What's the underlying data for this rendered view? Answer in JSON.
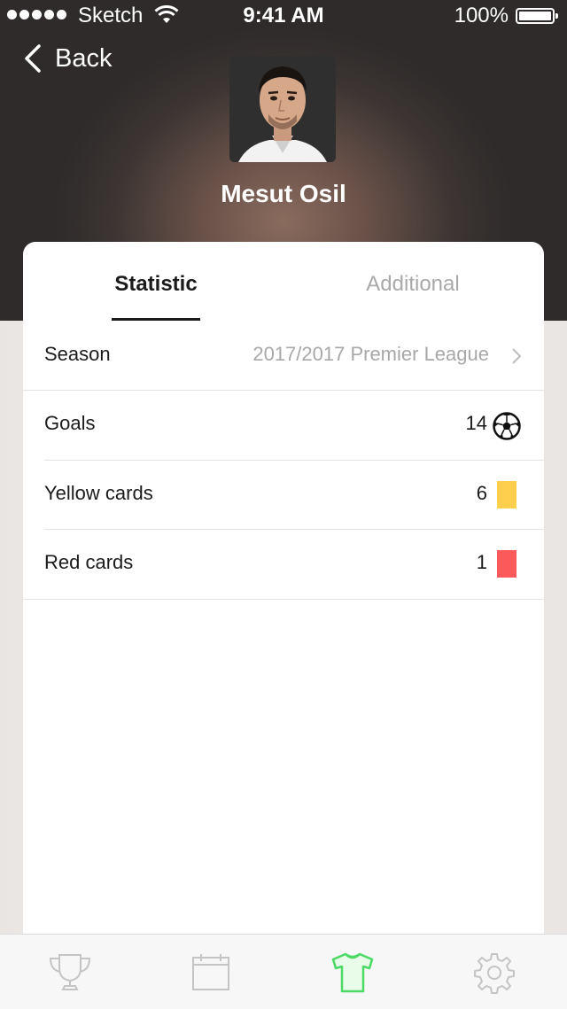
{
  "status_bar": {
    "carrier": "Sketch",
    "time": "9:41 AM",
    "battery": "100%"
  },
  "nav": {
    "back_label": "Back"
  },
  "player": {
    "name": "Mesut Osil"
  },
  "tabs": [
    {
      "label": "Statistic",
      "active": true
    },
    {
      "label": "Additional",
      "active": false
    }
  ],
  "season": {
    "label": "Season",
    "value": "2017/2017 Premier League"
  },
  "stats": [
    {
      "label": "Goals",
      "value": "14",
      "icon": "soccer-ball-icon"
    },
    {
      "label": "Yellow cards",
      "value": "6",
      "icon": "yellow-card-icon",
      "color": "#fdcf4d"
    },
    {
      "label": "Red cards",
      "value": "1",
      "icon": "red-card-icon",
      "color": "#fc5a5a"
    }
  ],
  "tabbar": [
    {
      "icon": "trophy-icon",
      "active": false
    },
    {
      "icon": "calendar-icon",
      "active": false
    },
    {
      "icon": "shirt-icon",
      "active": true
    },
    {
      "icon": "gear-icon",
      "active": false
    }
  ],
  "colors": {
    "active_tab": "#4cd964",
    "active_fill": "#e9fbe9",
    "inactive_icon": "#c4c4c4"
  }
}
